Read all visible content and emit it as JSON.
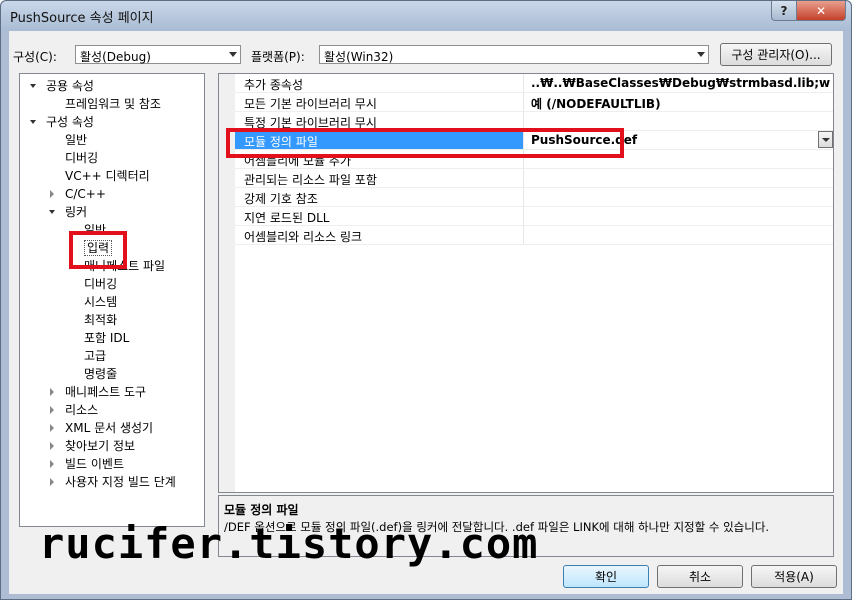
{
  "window": {
    "title": "PushSource 속성 페이지",
    "help_label": "?",
    "close_label": "✕"
  },
  "toolbar": {
    "config_label": "구성(C):",
    "config_value": "활성(Debug)",
    "platform_label": "플랫폼(P):",
    "platform_value": "활성(Win32)",
    "config_manager_label": "구성 관리자(O)..."
  },
  "tree": {
    "items": [
      {
        "label": "공용 속성",
        "state": "open"
      },
      {
        "label": "프레임워크 및 참조",
        "state": "leaf"
      },
      {
        "label": "구성 속성",
        "state": "open"
      },
      {
        "label": "일반",
        "state": "leaf"
      },
      {
        "label": "디버깅",
        "state": "leaf"
      },
      {
        "label": "VC++ 디렉터리",
        "state": "leaf"
      },
      {
        "label": "C/C++",
        "state": "closed"
      },
      {
        "label": "링커",
        "state": "open"
      },
      {
        "label": "일반",
        "state": "leaf"
      },
      {
        "label": "입력",
        "state": "leaf",
        "selected": true
      },
      {
        "label": "매니페스트 파일",
        "state": "leaf"
      },
      {
        "label": "디버깅",
        "state": "leaf"
      },
      {
        "label": "시스템",
        "state": "leaf"
      },
      {
        "label": "최적화",
        "state": "leaf"
      },
      {
        "label": "포함 IDL",
        "state": "leaf"
      },
      {
        "label": "고급",
        "state": "leaf"
      },
      {
        "label": "명령줄",
        "state": "leaf"
      },
      {
        "label": "매니페스트 도구",
        "state": "closed"
      },
      {
        "label": "리소스",
        "state": "closed"
      },
      {
        "label": "XML 문서 생성기",
        "state": "closed"
      },
      {
        "label": "찾아보기 정보",
        "state": "closed"
      },
      {
        "label": "빌드 이벤트",
        "state": "closed"
      },
      {
        "label": "사용자 지정 빌드 단계",
        "state": "closed"
      }
    ]
  },
  "properties": {
    "rows": [
      {
        "name": "추가 종속성",
        "value": "..₩..₩BaseClasses₩Debug₩strmbasd.lib;winmm.lib;msv"
      },
      {
        "name": "모든 기본 라이브러리 무시",
        "value": "예 (/NODEFAULTLIB)"
      },
      {
        "name": "특정 기본 라이브러리 무시",
        "value": ""
      },
      {
        "name": "모듈 정의 파일",
        "value": "PushSource.def",
        "selected": true
      },
      {
        "name": "어셈블리에 모듈 추가",
        "value": ""
      },
      {
        "name": "관리되는 리소스 파일 포함",
        "value": ""
      },
      {
        "name": "강제 기호 참조",
        "value": ""
      },
      {
        "name": "지연 로드된 DLL",
        "value": ""
      },
      {
        "name": "어셈블리와 리소스 링크",
        "value": ""
      }
    ]
  },
  "description": {
    "title": "모듈 정의 파일",
    "text": "/DEF 옵션으로 모듈 정의 파일(.def)을 링커에 전달합니다. .def 파일은 LINK에 대해 하나만 지정할 수 있습니다."
  },
  "buttons": {
    "ok": "확인",
    "cancel": "취소",
    "apply": "적용(A)"
  },
  "watermark": "rucifer.tistory.com",
  "colors": {
    "selection": "#3399ff",
    "highlight_box": "#e1101c"
  }
}
